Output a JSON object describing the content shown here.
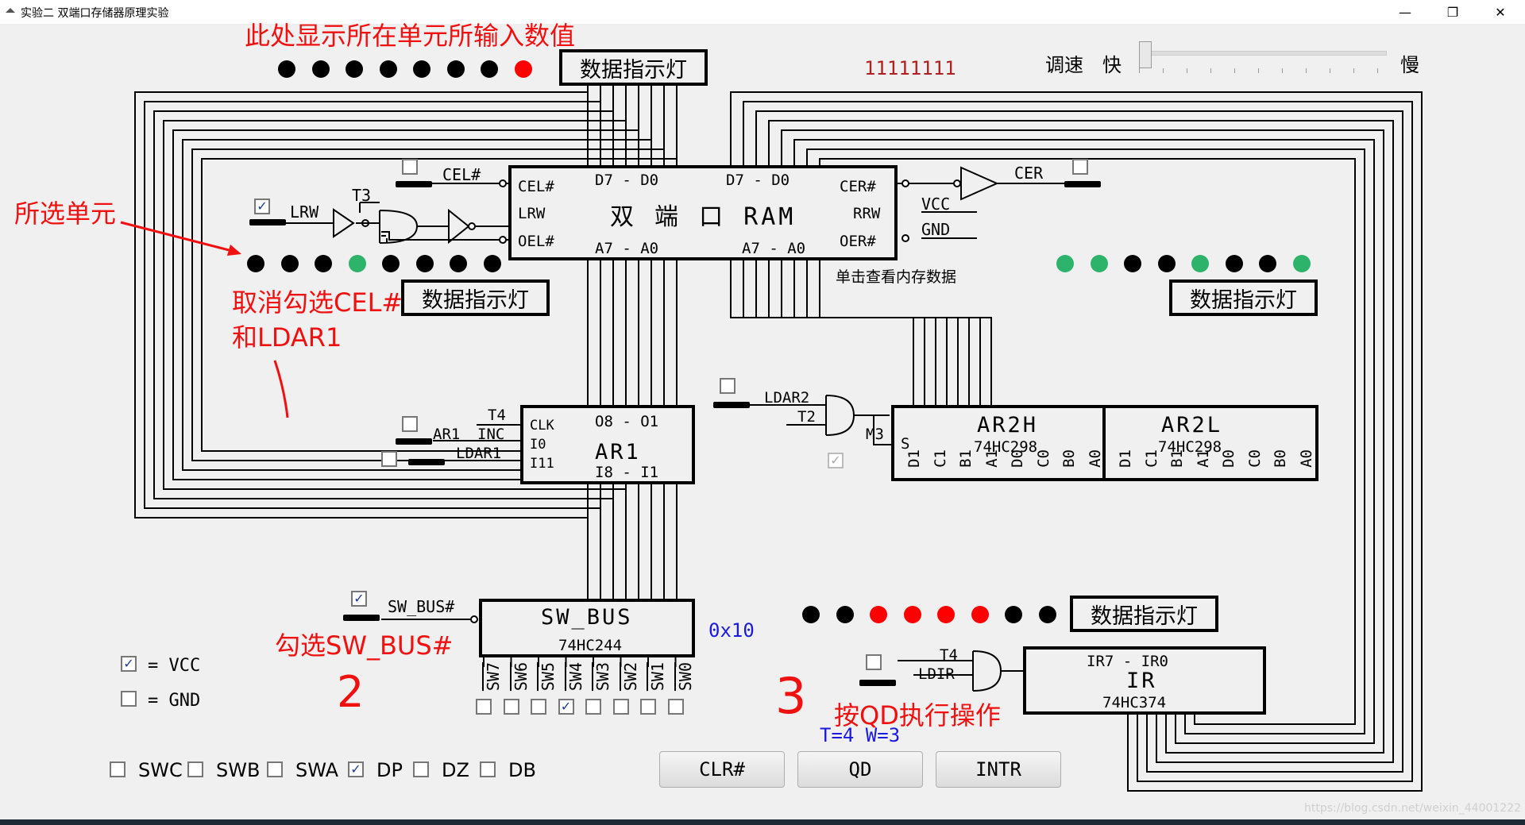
{
  "window": {
    "title": "实验二 双端口存储器原理实验",
    "minimize": "—",
    "restore": "❐",
    "close": "✕"
  },
  "top": {
    "display_value": "11111111",
    "speed_label": "调速",
    "fast": "快",
    "slow": "慢",
    "speed_level": 0.0,
    "indicator_title": "数据指示灯",
    "lights": [
      "black",
      "black",
      "black",
      "black",
      "black",
      "black",
      "black",
      "red"
    ]
  },
  "ram": {
    "title": "双 端 口  RAM",
    "left_data": "D7 - D0",
    "right_data": "D7 - D0",
    "left_addr": "A7 - A0",
    "right_addr": "A7 - A0",
    "cel": "CEL#",
    "lrw": "LRW",
    "oel": "OEL#",
    "cer": "CER#",
    "rrw": "RRW",
    "oer": "OER#",
    "ext_cel": "CEL#",
    "ext_lrw": "LRW",
    "ext_t3": "T3",
    "ext_cer": "CER",
    "vcc": "VCC",
    "gnd": "GND",
    "view_hint": "单击查看内存数据"
  },
  "left_lights": {
    "title": "数据指示灯",
    "lights": [
      "black",
      "black",
      "black",
      "green",
      "black",
      "black",
      "black",
      "black"
    ]
  },
  "right_lights": {
    "title": "数据指示灯",
    "lights": [
      "green",
      "green",
      "black",
      "black",
      "green",
      "black",
      "black",
      "green"
    ]
  },
  "ar1": {
    "title": "AR1",
    "out": "O8 - O1",
    "in": "I8 - I1",
    "clk": "CLK",
    "i0": "I0",
    "i11": "I11",
    "t4": "T4",
    "inc": "INC",
    "ar1_inc": "AR1",
    "ldar1": "LDAR1"
  },
  "ldar2": {
    "label": "LDAR2",
    "t2": "T2",
    "m3": "M3"
  },
  "ar2h": {
    "title": "AR2H",
    "chip": "74HC298",
    "s": "S",
    "pins": [
      "D1",
      "C1",
      "B1",
      "A1",
      "D0",
      "C0",
      "B0",
      "A0"
    ]
  },
  "ar2l": {
    "title": "AR2L",
    "chip": "74HC298",
    "pins": [
      "D1",
      "C1",
      "B1",
      "A1",
      "D0",
      "C0",
      "B0",
      "A0"
    ]
  },
  "swbus": {
    "title": "SW_BUS",
    "chip": "74HC244",
    "label": "SW_BUS#",
    "value": "0x10",
    "switches": [
      {
        "name": "SW7",
        "checked": false
      },
      {
        "name": "SW6",
        "checked": false
      },
      {
        "name": "SW5",
        "checked": false
      },
      {
        "name": "SW4",
        "checked": true
      },
      {
        "name": "SW3",
        "checked": false
      },
      {
        "name": "SW2",
        "checked": false
      },
      {
        "name": "SW1",
        "checked": false
      },
      {
        "name": "SW0",
        "checked": false
      }
    ]
  },
  "ir": {
    "title": "IR",
    "chip": "74HC374",
    "bits": "IR7 - IR0",
    "t4": "T4",
    "ldir": "LDIR",
    "indicator_title": "数据指示灯",
    "lights": [
      "black",
      "black",
      "red",
      "red",
      "red",
      "red",
      "black",
      "black"
    ]
  },
  "legend": {
    "vcc": "= VCC",
    "gnd": "= GND"
  },
  "modes": [
    {
      "name": "SWC",
      "checked": false
    },
    {
      "name": "SWB",
      "checked": false
    },
    {
      "name": "SWA",
      "checked": false
    },
    {
      "name": "DP",
      "checked": true
    },
    {
      "name": "DZ",
      "checked": false
    },
    {
      "name": "DB",
      "checked": false
    }
  ],
  "buttons": {
    "clr": "CLR#",
    "qd": "QD",
    "intr": "INTR"
  },
  "timing": "T=4  W=3",
  "annotations": {
    "top": "此处显示所在单元所输入数值",
    "selected": "所选单元",
    "cancel1": "取消勾选CEL#",
    "cancel2": "和LDAR1",
    "check_swbus": "勾选SW_BUS#",
    "step2": "2",
    "step3": "3",
    "step3_text": "按QD执行操作"
  },
  "watermark": "https://blog.csdn.net/weixin_44001222"
}
